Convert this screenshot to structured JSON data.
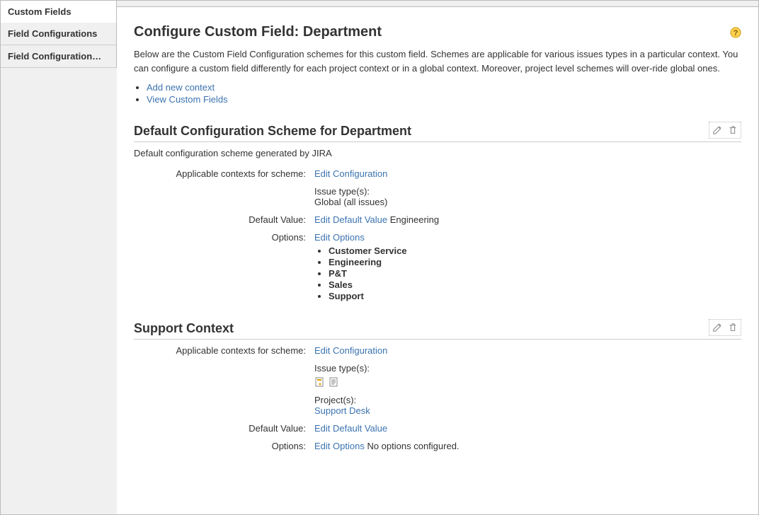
{
  "sidebar": {
    "header": "Custom Fields",
    "items": [
      {
        "label": "Field Configurations"
      },
      {
        "label": "Field Configuration…"
      }
    ]
  },
  "page": {
    "title": "Configure Custom Field: Department",
    "intro": "Below are the Custom Field Configuration schemes for this custom field. Schemes are applicable for various issues types in a particular context. You can configure a custom field differently for each project context or in a global context. Moreover, project level schemes will over-ride global ones."
  },
  "actions": {
    "add_context": "Add new context",
    "view_custom_fields": "View Custom Fields"
  },
  "labels": {
    "applicable_contexts": "Applicable contexts for scheme:",
    "default_value": "Default Value:",
    "options": "Options:",
    "edit_configuration": "Edit Configuration",
    "edit_default_value": "Edit Default Value",
    "edit_options": "Edit Options",
    "issue_types": "Issue type(s):",
    "projects": "Project(s):"
  },
  "schemes": [
    {
      "title": "Default Configuration Scheme for Department",
      "description": "Default configuration scheme generated by JIRA",
      "contexts": {
        "issue_types_text": "Global (all issues)",
        "issue_type_icons": [],
        "projects": []
      },
      "default_value_text": "Engineering",
      "options": [
        "Customer Service",
        "Engineering",
        "P&T",
        "Sales",
        "Support"
      ],
      "no_options_text": ""
    },
    {
      "title": "Support Context",
      "description": "",
      "contexts": {
        "issue_types_text": "",
        "issue_type_icons": [
          "issuetype-task-icon",
          "issuetype-document-icon"
        ],
        "projects": [
          "Support Desk"
        ]
      },
      "default_value_text": "",
      "options": [],
      "no_options_text": "No options configured."
    }
  ],
  "icons": {
    "help": "help-icon",
    "edit": "edit-icon",
    "delete": "delete-icon"
  }
}
